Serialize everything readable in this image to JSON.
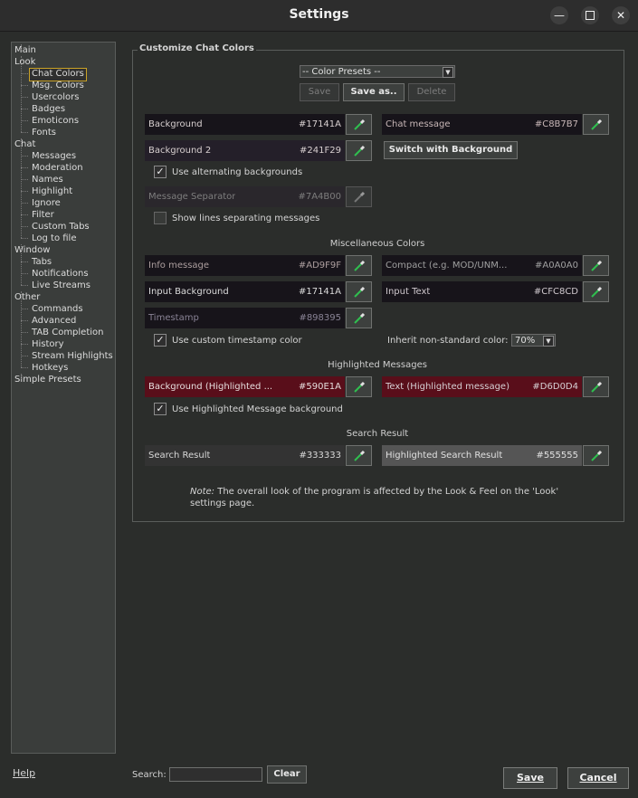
{
  "window": {
    "title": "Settings"
  },
  "nav": [
    {
      "label": "Main",
      "level": 0
    },
    {
      "label": "Look",
      "level": 0
    },
    {
      "label": "Chat Colors",
      "level": 1,
      "selected": true
    },
    {
      "label": "Msg. Colors",
      "level": 1
    },
    {
      "label": "Usercolors",
      "level": 1
    },
    {
      "label": "Badges",
      "level": 1
    },
    {
      "label": "Emoticons",
      "level": 1
    },
    {
      "label": "Fonts",
      "level": 1
    },
    {
      "label": "Chat",
      "level": 0
    },
    {
      "label": "Messages",
      "level": 1
    },
    {
      "label": "Moderation",
      "level": 1
    },
    {
      "label": "Names",
      "level": 1
    },
    {
      "label": "Highlight",
      "level": 1
    },
    {
      "label": "Ignore",
      "level": 1
    },
    {
      "label": "Filter",
      "level": 1
    },
    {
      "label": "Custom Tabs",
      "level": 1
    },
    {
      "label": "Log to file",
      "level": 1
    },
    {
      "label": "Window",
      "level": 0
    },
    {
      "label": "Tabs",
      "level": 1
    },
    {
      "label": "Notifications",
      "level": 1
    },
    {
      "label": "Live Streams",
      "level": 1
    },
    {
      "label": "Other",
      "level": 0
    },
    {
      "label": "Commands",
      "level": 1
    },
    {
      "label": "Advanced",
      "level": 1
    },
    {
      "label": "TAB Completion",
      "level": 1
    },
    {
      "label": "History",
      "level": 1
    },
    {
      "label": "Stream Highlights",
      "level": 1
    },
    {
      "label": "Hotkeys",
      "level": 1
    },
    {
      "label": "Simple Presets",
      "level": 0
    }
  ],
  "group": {
    "title": "Customize Chat Colors"
  },
  "presets": {
    "combo_value": "-- Color Presets --",
    "save_label": "Save",
    "save_as_label": "Save as..",
    "delete_label": "Delete"
  },
  "colors": {
    "background": {
      "label": "Background",
      "hex": "#17141A"
    },
    "chat_message": {
      "label": "Chat message",
      "hex": "#C8B7B7"
    },
    "background2": {
      "label": "Background 2",
      "hex": "#241F29"
    },
    "switch_label": "Switch with Background",
    "use_alternating": "Use alternating backgrounds",
    "separator": {
      "label": "Message Separator",
      "hex": "#7A4B00"
    },
    "show_lines": "Show lines separating messages"
  },
  "misc": {
    "title": "Miscellaneous Colors",
    "info": {
      "label": "Info message",
      "hex": "#AD9F9F"
    },
    "compact": {
      "label": "Compact (e.g. MOD/UNM...",
      "hex": "#A0A0A0"
    },
    "input_bg": {
      "label": "Input Background",
      "hex": "#17141A"
    },
    "input_text": {
      "label": "Input Text",
      "hex": "#CFC8CD"
    },
    "timestamp": {
      "label": "Timestamp",
      "hex": "#898395"
    },
    "use_custom_timestamp": "Use custom timestamp color",
    "inherit_label": "Inherit non-standard color:",
    "inherit_value": "70%"
  },
  "highlighted": {
    "title": "Highlighted Messages",
    "background": {
      "label": "Background (Highlighted ...",
      "hex": "#590E1A"
    },
    "text": {
      "label": "Text (Highlighted message)",
      "hex": "#D6D0D4"
    },
    "use_bg": "Use Highlighted Message background"
  },
  "search_result": {
    "title": "Search Result",
    "result": {
      "label": "Search Result",
      "hex": "#333333"
    },
    "highlighted": {
      "label": "Highlighted Search Result",
      "hex": "#555555"
    }
  },
  "note": {
    "prefix": "Note:",
    "line1": " The overall look of the program is affected by the Look & Feel on the 'Look'",
    "line2": "settings page."
  },
  "footer": {
    "help": "Help",
    "search_label": "Search:",
    "search_value": "",
    "clear": "Clear",
    "save": "Save",
    "cancel": "Cancel"
  },
  "palette": {
    "accent_selected": "#c9a227",
    "dropper_tip": "#2fbf4f"
  }
}
